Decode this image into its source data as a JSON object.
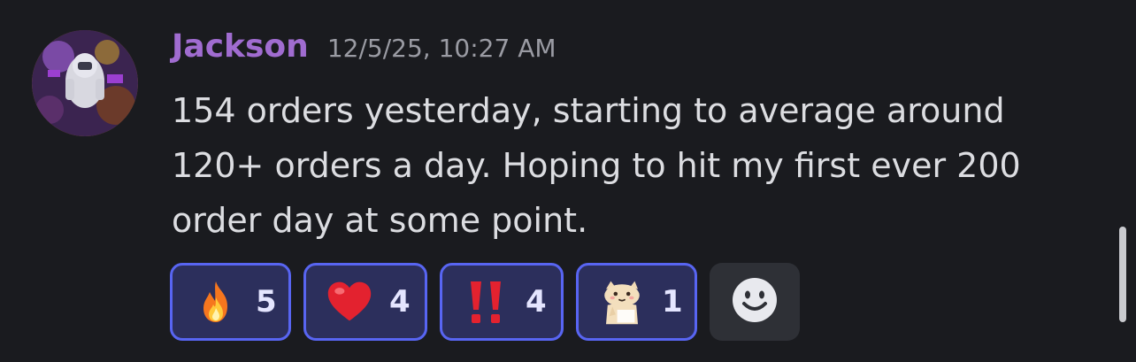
{
  "message": {
    "author": "Jackson",
    "timestamp": "12/5/25, 10:27 AM",
    "text": "154 orders yesterday, starting to average around 120+ orders a day. Hoping to hit my first ever 200 order day at some point.",
    "author_color": "#a06cd0"
  },
  "reactions": [
    {
      "emoji": "fire-icon",
      "count": "5"
    },
    {
      "emoji": "heart-icon",
      "count": "4"
    },
    {
      "emoji": "double-exclamation-icon",
      "count": "4"
    },
    {
      "emoji": "cat-sticker-icon",
      "count": "1"
    }
  ],
  "add_reaction": {
    "icon": "smiley-add-icon"
  },
  "colors": {
    "background": "#1a1b1f",
    "reaction_border": "#5865f2",
    "reaction_bg": "#2c2f5c"
  }
}
